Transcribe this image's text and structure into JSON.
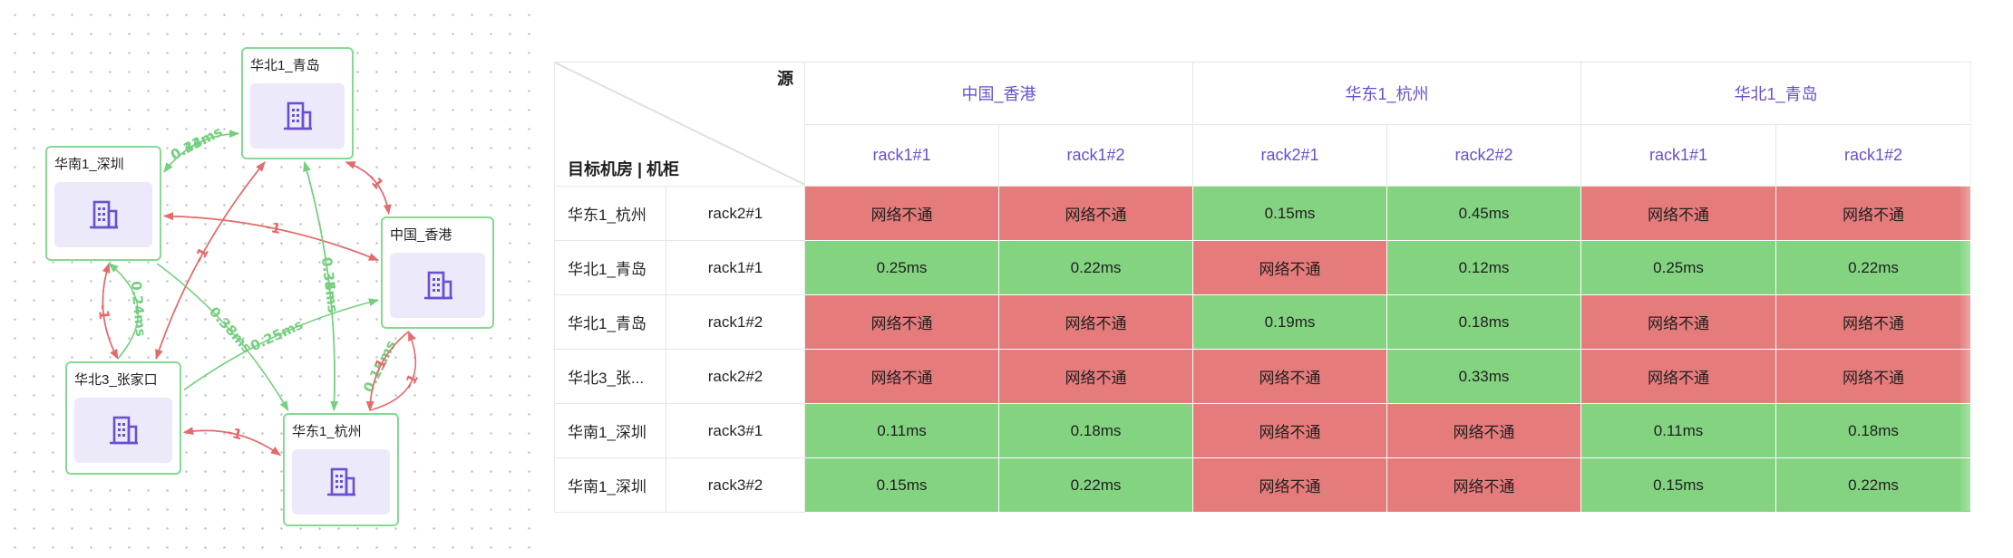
{
  "colors": {
    "good": "#83d380",
    "bad": "#e67b7b",
    "node_border": "#86d993",
    "header_text": "#6a4fcf",
    "icon": "#6a4fcf",
    "edge_green": "#74cf7e",
    "edge_red": "#e46b6b"
  },
  "topology": {
    "nodes": [
      {
        "id": "qd",
        "label": "华北1_青岛",
        "icon": "building-icon"
      },
      {
        "id": "sz",
        "label": "华南1_深圳",
        "icon": "building-icon"
      },
      {
        "id": "hk",
        "label": "中国_香港",
        "icon": "building-icon"
      },
      {
        "id": "zjk",
        "label": "华北3_张家口",
        "icon": "building-icon"
      },
      {
        "id": "hz",
        "label": "华东1_杭州",
        "icon": "building-icon"
      }
    ],
    "edges": [
      {
        "from": "sz",
        "to": "qd",
        "label": "0.44ms",
        "status": "ok"
      },
      {
        "from": "qd",
        "to": "sz",
        "label": "0.33ms",
        "status": "ok"
      },
      {
        "from": "qd",
        "to": "hk",
        "label": "-1",
        "status": "fail"
      },
      {
        "from": "hk",
        "to": "qd",
        "label": "-1",
        "status": "fail"
      },
      {
        "from": "sz",
        "to": "hk",
        "label": "-1",
        "status": "fail"
      },
      {
        "from": "hk",
        "to": "sz",
        "label": "-1",
        "status": "fail"
      },
      {
        "from": "sz",
        "to": "zjk",
        "label": "-1",
        "status": "fail"
      },
      {
        "from": "zjk",
        "to": "sz",
        "label": "-1",
        "status": "fail"
      },
      {
        "from": "zjk",
        "to": "qd",
        "label": "-1",
        "status": "fail"
      },
      {
        "from": "qd",
        "to": "zjk",
        "label": "-1",
        "status": "fail"
      },
      {
        "from": "hz",
        "to": "qd",
        "label": "0.34ms",
        "status": "ok"
      },
      {
        "from": "qd",
        "to": "hz",
        "label": "0.35ms",
        "status": "ok"
      },
      {
        "from": "sz",
        "to": "hz",
        "label": "0.38ms",
        "status": "ok"
      },
      {
        "from": "zjk",
        "to": "hk",
        "label": "0.25ms",
        "status": "ok"
      },
      {
        "from": "zjk",
        "to": "sz",
        "label": "0.24ms",
        "status": "ok"
      },
      {
        "from": "hk",
        "to": "hz",
        "label": "0.15ms",
        "status": "ok"
      },
      {
        "from": "hk",
        "to": "hz",
        "label": "-1",
        "status": "fail"
      },
      {
        "from": "hz",
        "to": "hk",
        "label": "-1",
        "status": "fail"
      },
      {
        "from": "zjk",
        "to": "hz",
        "label": "-1",
        "status": "fail"
      },
      {
        "from": "hz",
        "to": "zjk",
        "label": "-1",
        "status": "fail"
      }
    ]
  },
  "matrix": {
    "corner": {
      "source_label": "源",
      "target_label": "目标机房 | 机柜"
    },
    "source_regions": [
      {
        "name": "中国_香港",
        "racks": [
          "rack1#1",
          "rack1#2"
        ]
      },
      {
        "name": "华东1_杭州",
        "racks": [
          "rack2#1",
          "rack2#2"
        ]
      },
      {
        "name": "华北1_青岛",
        "racks": [
          "rack1#1",
          "rack1#2"
        ]
      }
    ],
    "rows": [
      {
        "region": "华东1_杭州",
        "rack": "rack2#1",
        "values": [
          "网络不通",
          "网络不通",
          "0.15ms",
          "0.45ms",
          "网络不通",
          "网络不通"
        ]
      },
      {
        "region": "华北1_青岛",
        "rack": "rack1#1",
        "values": [
          "0.25ms",
          "0.22ms",
          "网络不通",
          "0.12ms",
          "0.25ms",
          "0.22ms"
        ]
      },
      {
        "region": "华北1_青岛",
        "rack": "rack1#2",
        "values": [
          "网络不通",
          "网络不通",
          "0.19ms",
          "0.18ms",
          "网络不通",
          "网络不通"
        ]
      },
      {
        "region": "华北3_张...",
        "rack": "rack2#2",
        "values": [
          "网络不通",
          "网络不通",
          "网络不通",
          "0.33ms",
          "网络不通",
          "网络不通"
        ]
      },
      {
        "region": "华南1_深圳",
        "rack": "rack3#1",
        "values": [
          "0.11ms",
          "0.18ms",
          "网络不通",
          "网络不通",
          "0.11ms",
          "0.18ms"
        ]
      },
      {
        "region": "华南1_深圳",
        "rack": "rack3#2",
        "values": [
          "0.15ms",
          "0.22ms",
          "网络不通",
          "网络不通",
          "0.15ms",
          "0.22ms"
        ]
      }
    ],
    "failure_text": "网络不通"
  }
}
